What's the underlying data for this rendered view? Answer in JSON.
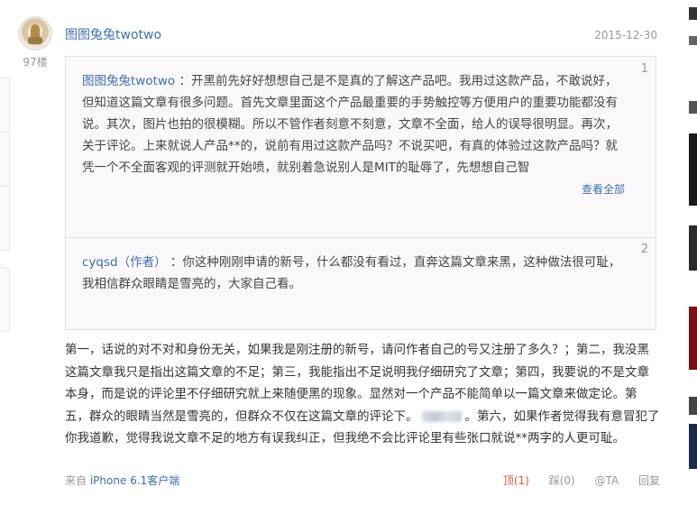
{
  "comment": {
    "username": "图图兔兔twotwo",
    "date": "2015-12-30",
    "floor": "97楼",
    "quotes": [
      {
        "index": "1",
        "name": "图图兔兔twotwo",
        "separator": "：",
        "text": "开黑前先好好想想自己是不是真的了解这产品吧。我用过这款产品，不敢说好，但知道这篇文章有很多问题。首先文章里面这个产品最重要的手势触控等方便用户的重要功能都没有说。其次，图片也拍的很模糊。所以不管作者刻意不刻意，文章不全面，给人的误导很明显。再次，关于评论。上来就说人产品**的，说前有用过这款产品吗？不说买吧，有真的体验过这款产品吗？就凭一个不全面客观的评测就开始喷，就别着急说别人是MIT的耻辱了，先想想自己智",
        "more_label": "查看全部"
      },
      {
        "index": "2",
        "name": "cyqsd（作者）",
        "separator": "：",
        "text": "你这种刚刚申请的新号，什么都没有看过，直奔这篇文章来黑，这种做法很可耻，我相信群众眼睛是雪亮的，大家自己看。"
      }
    ],
    "body_part1": "第一，话说的对不对和身份无关，如果我是刚注册的新号，请问作者自己的号又注册了多久？；第二，我没黑这篇文章我只是指出这篇文章的不足；第三，我能指出不足说明我仔细研究了文章；第四，我要说的不是文章本身，而是说的评论里不仔细研究就上来随便黑的现象。显然对一个产品不能简单以一篇文章来做定论。第五，群众的眼睛当然是雪亮的，但群众不仅在这篇文章的评论下。",
    "body_part2": "。第六，如果作者觉得我有意冒犯了你我道歉，觉得我说文章不足的地方有误我纠正，但我绝不会比评论里有些张口就说**两字的人更可耻。",
    "footer": {
      "source_prefix": "来自",
      "source_link": "iPhone 6.1客户端",
      "up_label": "顶(1)",
      "down_label": "踩(0)",
      "at_label": "@TA",
      "reply_label": "回复"
    }
  },
  "colors": {
    "link": "#3d6fb0",
    "muted": "#999999",
    "upvote": "#e0553d",
    "quote_bg": "#fbf8fc"
  }
}
